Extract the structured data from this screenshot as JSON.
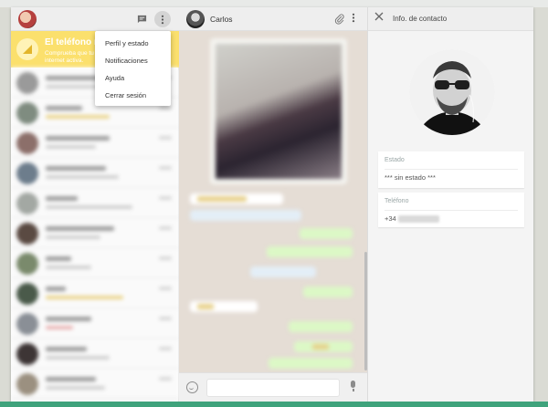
{
  "left": {
    "banner": {
      "title": "El teléfono no esta",
      "subtitle": "Comprueba que tu teléfono está conectado a internet activa."
    },
    "menu": {
      "items": [
        "Perfil y estado",
        "Notificaciones",
        "Ayuda",
        "Cerrar sesión"
      ]
    },
    "icons": {
      "chat": "chat-icon",
      "menu": "more-vert-icon",
      "banner": "phone-offline-icon"
    }
  },
  "conversation": {
    "contact_name": "Carlos",
    "icons": {
      "attach": "paperclip-icon",
      "menu": "more-vert-icon",
      "emoji": "emoji-icon",
      "mic": "mic-icon"
    }
  },
  "contact_info": {
    "title": "Info. de contacto",
    "estado_label": "Estado",
    "estado_value": "*** sin estado ***",
    "telefono_label": "Teléfono",
    "telefono_prefix": "+34",
    "icons": {
      "close": "close-icon"
    }
  },
  "colors": {
    "banner": "#fbe06d",
    "outgoing_bubble": "#dcf8c6",
    "chat_bg": "#e5ddd5",
    "accent_bar": "#3fa37c"
  }
}
